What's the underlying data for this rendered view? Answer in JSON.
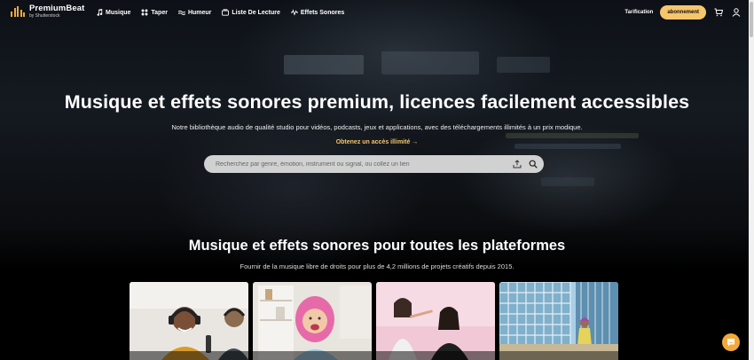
{
  "brand": {
    "title": "PremiumBeat",
    "subtitle": "by Shutterstock",
    "accent": "#f2a93b"
  },
  "nav": {
    "items": [
      {
        "label": "Musique",
        "icon": "music-note-icon"
      },
      {
        "label": "Taper",
        "icon": "grid-icon"
      },
      {
        "label": "Humeur",
        "icon": "wave-icon"
      },
      {
        "label": "Liste De Lecture",
        "icon": "playlist-icon"
      },
      {
        "label": "Effets Sonores",
        "icon": "sparkle-icon"
      }
    ],
    "pricing": "Tarification",
    "subscribe": "abonnement",
    "cart_icon": "cart-icon",
    "account_icon": "user-icon"
  },
  "hero": {
    "title": "Musique et effets sonores premium, licences facilement accessibles",
    "subtitle": "Notre bibliothèque audio de qualité studio pour vidéos, podcasts, jeux et applications, avec des téléchargements illimités à un prix modique.",
    "cta": "Obtenez un accès illimité →",
    "search_placeholder": "Recherchez par genre, émotion, instrument ou signal, ou collez un lien"
  },
  "section": {
    "title": "Musique et effets sonores pour toutes les plateformes",
    "subtitle": "Fournir de la musique libre de droits pour plus de 4,2 millions de projets créatifs depuis 2015."
  },
  "colors": {
    "accent_button": "#f5c66b",
    "cta_text": "#f5c66b",
    "chat": "#f2a93b"
  }
}
